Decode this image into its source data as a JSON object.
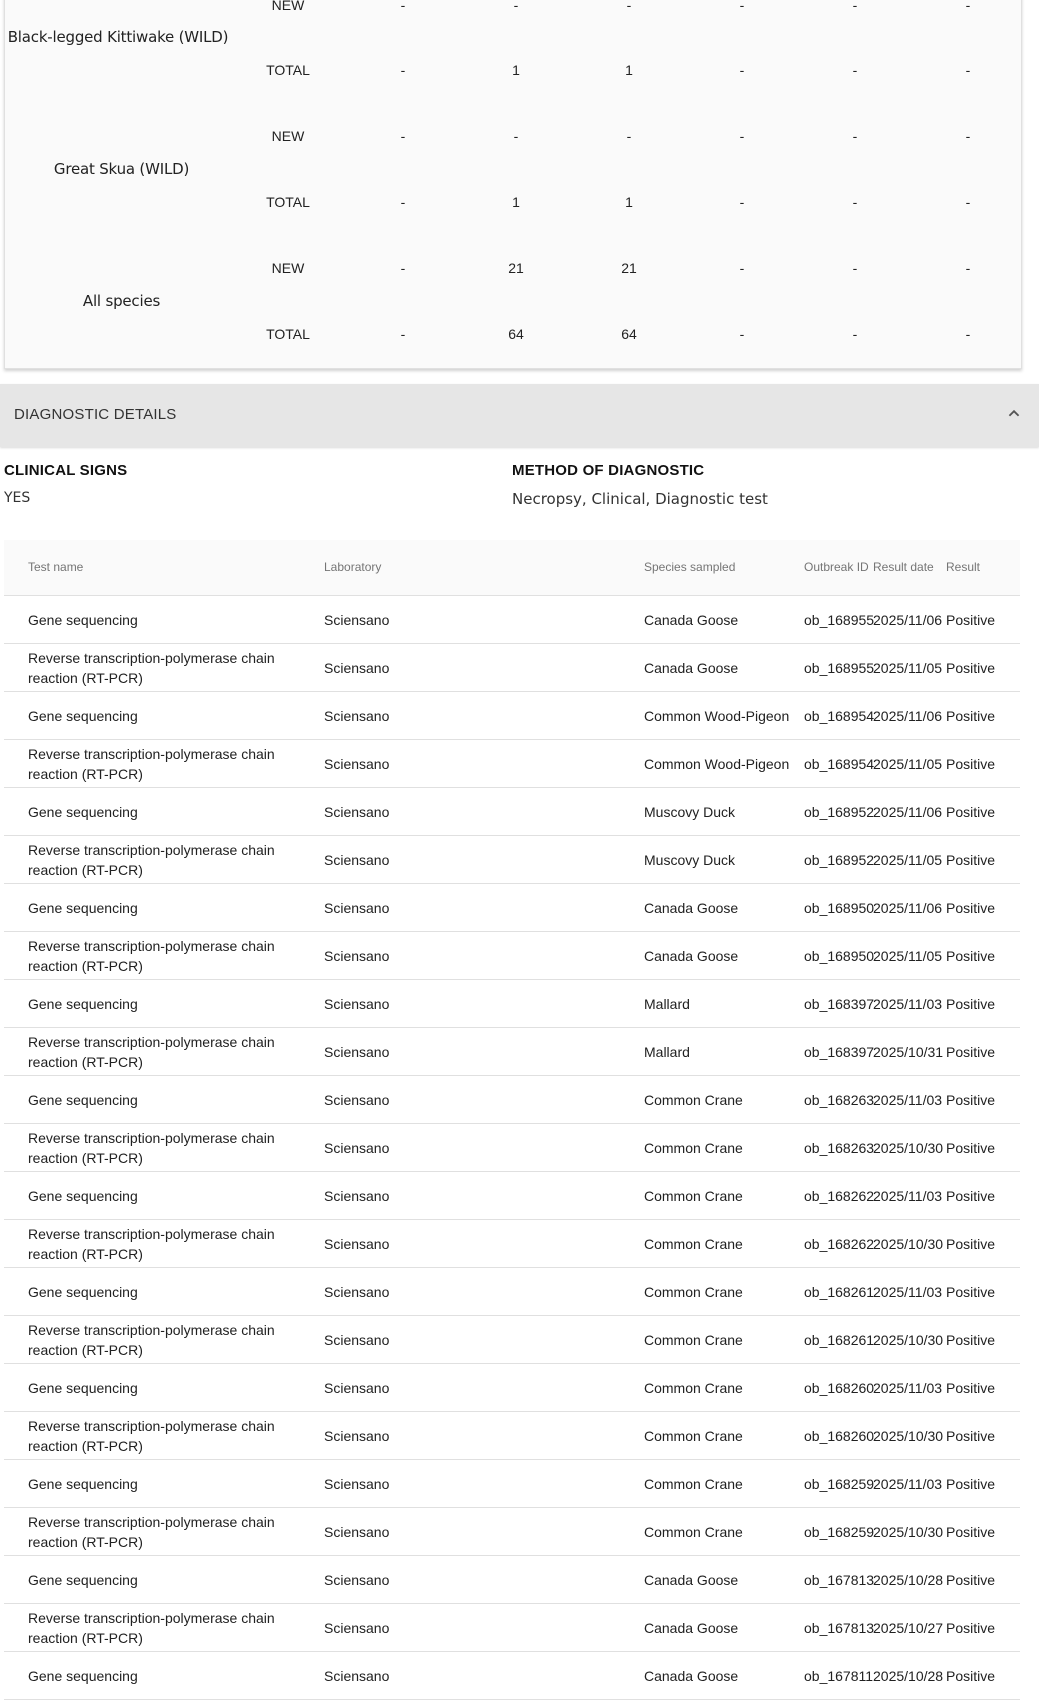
{
  "summary": {
    "rows": [
      {
        "species": "Black-legged Kittiwake (WILD)",
        "new": [
          "-",
          "-",
          "-",
          "-",
          "-",
          "-"
        ],
        "total": [
          "-",
          "1",
          "1",
          "-",
          "-",
          "-"
        ]
      },
      {
        "species": "Great Skua (WILD)",
        "new": [
          "-",
          "-",
          "-",
          "-",
          "-",
          "-"
        ],
        "total": [
          "-",
          "1",
          "1",
          "-",
          "-",
          "-"
        ]
      },
      {
        "species": "All species",
        "new": [
          "-",
          "21",
          "21",
          "-",
          "-",
          "-"
        ],
        "total": [
          "-",
          "64",
          "64",
          "-",
          "-",
          "-"
        ]
      }
    ],
    "new_label": "NEW",
    "total_label": "TOTAL"
  },
  "diagnostic": {
    "section_title": "DIAGNOSTIC DETAILS",
    "clinical_signs_label": "CLINICAL SIGNS",
    "clinical_signs_value": "YES",
    "method_label": "METHOD OF DIAGNOSTIC",
    "method_value": "Necropsy, Clinical, Diagnostic test"
  },
  "tests": {
    "headers": {
      "test_name": "Test name",
      "laboratory": "Laboratory",
      "species": "Species sampled",
      "outbreak_id": "Outbreak ID",
      "result_date": "Result date",
      "result": "Result"
    },
    "rows": [
      {
        "test": "Gene sequencing",
        "lab": "Sciensano",
        "species": "Canada Goose",
        "outbreak": "ob_168955",
        "date": "2025/11/06",
        "result": "Positive"
      },
      {
        "test": "Reverse transcription-polymerase chain reaction (RT-PCR)",
        "lab": "Sciensano",
        "species": "Canada Goose",
        "outbreak": "ob_168955",
        "date": "2025/11/05",
        "result": "Positive"
      },
      {
        "test": "Gene sequencing",
        "lab": "Sciensano",
        "species": "Common Wood-Pigeon",
        "outbreak": "ob_168954",
        "date": "2025/11/06",
        "result": "Positive"
      },
      {
        "test": "Reverse transcription-polymerase chain reaction (RT-PCR)",
        "lab": "Sciensano",
        "species": "Common Wood-Pigeon",
        "outbreak": "ob_168954",
        "date": "2025/11/05",
        "result": "Positive"
      },
      {
        "test": "Gene sequencing",
        "lab": "Sciensano",
        "species": "Muscovy Duck",
        "outbreak": "ob_168952",
        "date": "2025/11/06",
        "result": "Positive"
      },
      {
        "test": "Reverse transcription-polymerase chain reaction (RT-PCR)",
        "lab": "Sciensano",
        "species": "Muscovy Duck",
        "outbreak": "ob_168952",
        "date": "2025/11/05",
        "result": "Positive"
      },
      {
        "test": "Gene sequencing",
        "lab": "Sciensano",
        "species": "Canada Goose",
        "outbreak": "ob_168950",
        "date": "2025/11/06",
        "result": "Positive"
      },
      {
        "test": "Reverse transcription-polymerase chain reaction (RT-PCR)",
        "lab": "Sciensano",
        "species": "Canada Goose",
        "outbreak": "ob_168950",
        "date": "2025/11/05",
        "result": "Positive"
      },
      {
        "test": "Gene sequencing",
        "lab": "Sciensano",
        "species": "Mallard",
        "outbreak": "ob_168397",
        "date": "2025/11/03",
        "result": "Positive"
      },
      {
        "test": "Reverse transcription-polymerase chain reaction (RT-PCR)",
        "lab": "Sciensano",
        "species": "Mallard",
        "outbreak": "ob_168397",
        "date": "2025/10/31",
        "result": "Positive"
      },
      {
        "test": "Gene sequencing",
        "lab": "Sciensano",
        "species": "Common Crane",
        "outbreak": "ob_168263",
        "date": "2025/11/03",
        "result": "Positive"
      },
      {
        "test": "Reverse transcription-polymerase chain reaction (RT-PCR)",
        "lab": "Sciensano",
        "species": "Common Crane",
        "outbreak": "ob_168263",
        "date": "2025/10/30",
        "result": "Positive"
      },
      {
        "test": "Gene sequencing",
        "lab": "Sciensano",
        "species": "Common Crane",
        "outbreak": "ob_168262",
        "date": "2025/11/03",
        "result": "Positive"
      },
      {
        "test": "Reverse transcription-polymerase chain reaction (RT-PCR)",
        "lab": "Sciensano",
        "species": "Common Crane",
        "outbreak": "ob_168262",
        "date": "2025/10/30",
        "result": "Positive"
      },
      {
        "test": "Gene sequencing",
        "lab": "Sciensano",
        "species": "Common Crane",
        "outbreak": "ob_168261",
        "date": "2025/11/03",
        "result": "Positive"
      },
      {
        "test": "Reverse transcription-polymerase chain reaction (RT-PCR)",
        "lab": "Sciensano",
        "species": "Common Crane",
        "outbreak": "ob_168261",
        "date": "2025/10/30",
        "result": "Positive"
      },
      {
        "test": "Gene sequencing",
        "lab": "Sciensano",
        "species": "Common Crane",
        "outbreak": "ob_168260",
        "date": "2025/11/03",
        "result": "Positive"
      },
      {
        "test": "Reverse transcription-polymerase chain reaction (RT-PCR)",
        "lab": "Sciensano",
        "species": "Common Crane",
        "outbreak": "ob_168260",
        "date": "2025/10/30",
        "result": "Positive"
      },
      {
        "test": "Gene sequencing",
        "lab": "Sciensano",
        "species": "Common Crane",
        "outbreak": "ob_168259",
        "date": "2025/11/03",
        "result": "Positive"
      },
      {
        "test": "Reverse transcription-polymerase chain reaction (RT-PCR)",
        "lab": "Sciensano",
        "species": "Common Crane",
        "outbreak": "ob_168259",
        "date": "2025/10/30",
        "result": "Positive"
      },
      {
        "test": "Gene sequencing",
        "lab": "Sciensano",
        "species": "Canada Goose",
        "outbreak": "ob_167813",
        "date": "2025/10/28",
        "result": "Positive"
      },
      {
        "test": "Reverse transcription-polymerase chain reaction (RT-PCR)",
        "lab": "Sciensano",
        "species": "Canada Goose",
        "outbreak": "ob_167813",
        "date": "2025/10/27",
        "result": "Positive"
      },
      {
        "test": "Gene sequencing",
        "lab": "Sciensano",
        "species": "Canada Goose",
        "outbreak": "ob_167811",
        "date": "2025/10/28",
        "result": "Positive"
      }
    ]
  }
}
